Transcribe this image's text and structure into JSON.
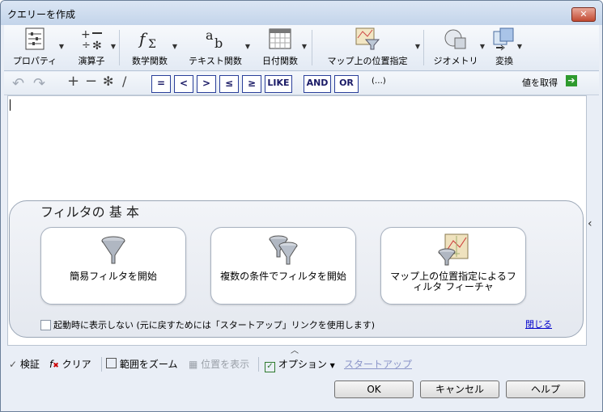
{
  "window": {
    "title": "クエリーを作成",
    "close_label": "✕"
  },
  "ribbon": {
    "properties": "プロパティ",
    "operators": "演算子",
    "math": "数学関数",
    "text": "テキスト関数",
    "date": "日付関数",
    "map_location": "マップ上の位置指定",
    "geometry": "ジオメトリ",
    "transform": "変換"
  },
  "operators_bar": {
    "eq": "=",
    "lt": "<",
    "gt": ">",
    "le": "≤",
    "ge": "≥",
    "like": "LIKE",
    "and": "AND",
    "or": "OR",
    "paren": "(…)",
    "get_values": "値を取得"
  },
  "filter_panel": {
    "title": "フィルタの 基 本",
    "cards": [
      {
        "label": "簡易フィルタを開始"
      },
      {
        "label": "複数の条件でフィルタを開始"
      },
      {
        "label": "マップ上の位置指定によるフィルタ フィーチャ"
      }
    ],
    "checkbox_label": "起動時に表示しない (元に戻すためには「スタートアップ」リンクを使用します)",
    "close_link": "閉じる"
  },
  "bottom": {
    "validate": "検証",
    "clear": "クリア",
    "zoom_extent": "範囲をズーム",
    "show_location": "位置を表示",
    "options": "オプション",
    "startup": "スタートアップ"
  },
  "buttons": {
    "ok": "OK",
    "cancel": "キャンセル",
    "help": "ヘルプ"
  },
  "colors": {
    "accent_green": "#2e9a2e",
    "link_blue": "#0000cc",
    "close_red": "#c24a32"
  }
}
